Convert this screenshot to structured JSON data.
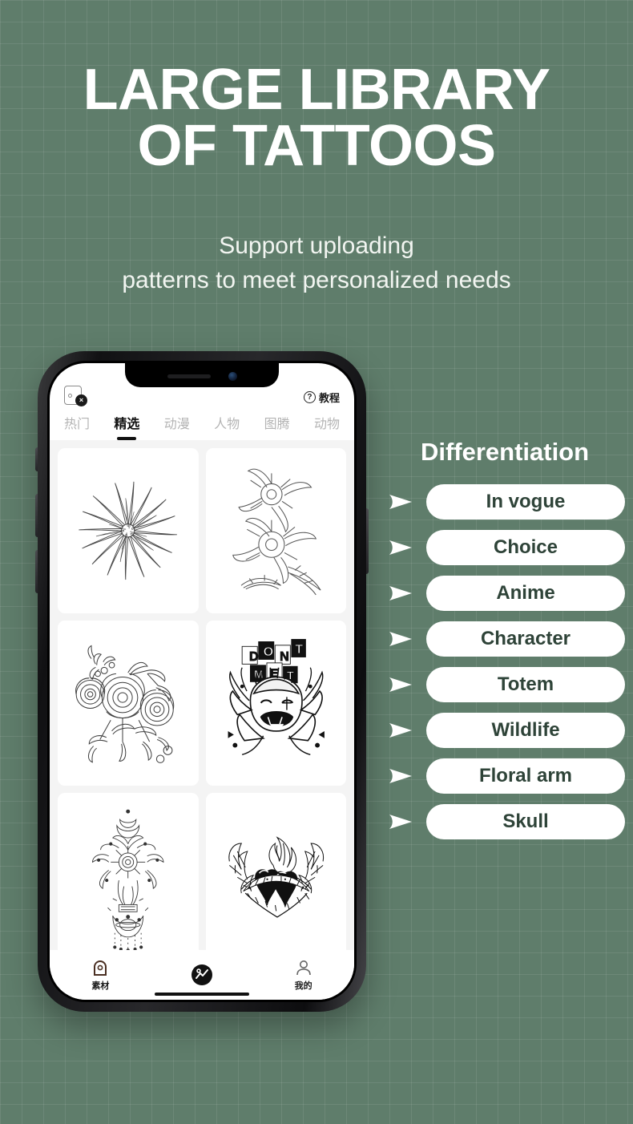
{
  "theme": {
    "background": "#5f7d6b",
    "headline_color": "#ffffff",
    "pill_bg": "#ffffff",
    "pill_text": "#2e4338",
    "accent_dark": "#111111"
  },
  "hero": {
    "title_line1": "LARGE LIBRARY",
    "title_line2": "OF TATTOOS",
    "subtitle_line1": "Support uploading",
    "subtitle_line2": "patterns to meet personalized needs"
  },
  "phone": {
    "app_header": {
      "bag_icon": "bag-with-close-badge-icon",
      "bag_badge": "×",
      "tutorial_icon": "question-circle-icon",
      "tutorial_mark": "?",
      "tutorial_label": "教程"
    },
    "tabs": [
      {
        "label": "热门",
        "active": false
      },
      {
        "label": "精选",
        "active": true
      },
      {
        "label": "动漫",
        "active": false
      },
      {
        "label": "人物",
        "active": false
      },
      {
        "label": "图腾",
        "active": false
      },
      {
        "label": "动物",
        "active": false
      }
    ],
    "cards": [
      {
        "name": "chrysanthemum-bloom",
        "art": "chrysanthemum"
      },
      {
        "name": "chrysanthemum-branch",
        "art": "branch"
      },
      {
        "name": "rose-bouquet",
        "art": "roses"
      },
      {
        "name": "anime-character",
        "art": "anime"
      },
      {
        "name": "celestial-sun-moon",
        "art": "celestial"
      },
      {
        "name": "winged-flaming-heart",
        "art": "heart"
      }
    ],
    "bottom_nav": [
      {
        "label": "素材",
        "icon": "arch-material-icon"
      },
      {
        "label": "",
        "icon": "create-circle-icon"
      },
      {
        "label": "我的",
        "icon": "person-icon"
      }
    ]
  },
  "right_panel": {
    "title": "Differentiation",
    "items": [
      {
        "label": "In vogue"
      },
      {
        "label": "Choice"
      },
      {
        "label": "Anime"
      },
      {
        "label": "Character"
      },
      {
        "label": "Totem"
      },
      {
        "label": "Wildlife"
      },
      {
        "label": "Floral arm"
      },
      {
        "label": "Skull"
      }
    ]
  }
}
